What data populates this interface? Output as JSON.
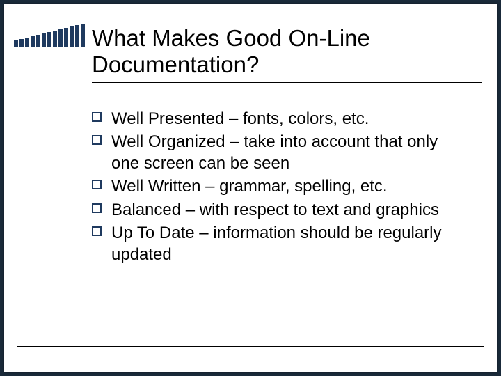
{
  "title": "What Makes Good On-Line Documentation?",
  "bullets": [
    "Well Presented – fonts, colors, etc.",
    "Well Organized – take into account that only one screen can be seen",
    "Well Written – grammar, spelling, etc.",
    "Balanced – with respect to text and graphics",
    "Up To Date – information should be regularly updated"
  ]
}
